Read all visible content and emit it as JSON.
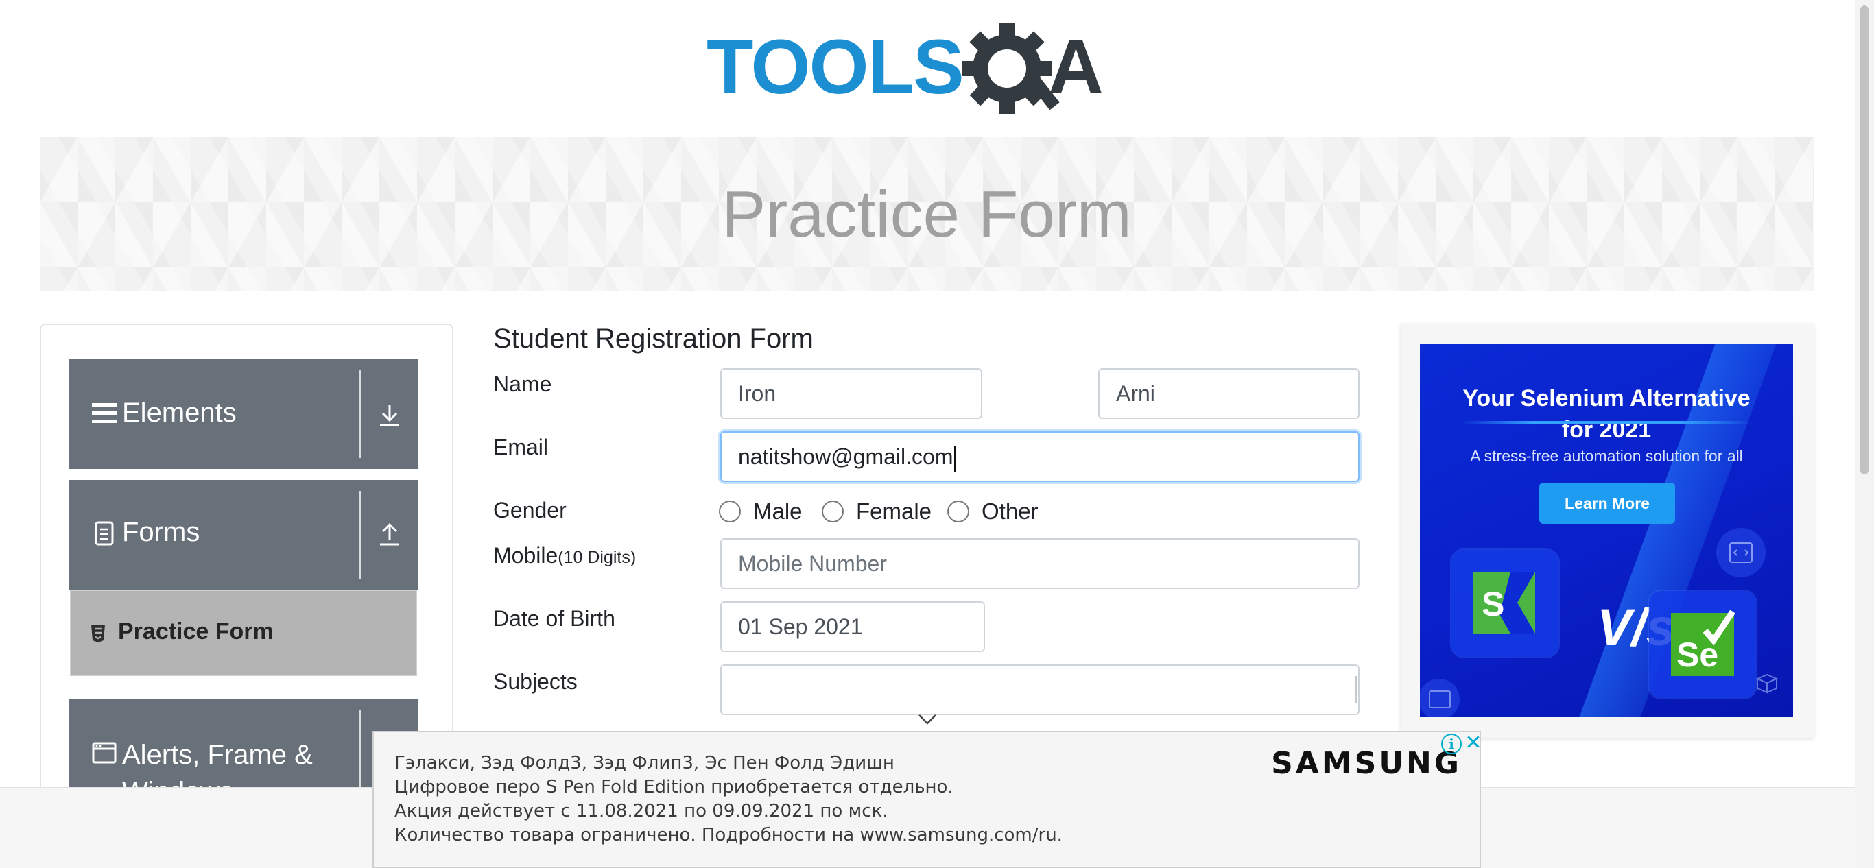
{
  "logo": {
    "text_part": "TOOLS",
    "qa_part": "QA",
    "colors": {
      "tools": "#1b8fd2",
      "qa": "#333a40"
    }
  },
  "banner": {
    "title": "Practice Form"
  },
  "sidebar": {
    "groups": [
      {
        "label": "Elements",
        "icon": "hamburger-icon",
        "toggle_icon": "download-arrow-icon",
        "expanded": false
      },
      {
        "label": "Forms",
        "icon": "document-icon",
        "toggle_icon": "upload-arrow-icon",
        "expanded": true,
        "items": [
          {
            "label": "Practice Form",
            "icon": "html5-icon",
            "active": true
          }
        ]
      },
      {
        "label": "Alerts, Frame &",
        "label_line2": "Windows",
        "icon": "window-icon"
      }
    ]
  },
  "form": {
    "title": "Student Registration Form",
    "labels": {
      "name": "Name",
      "email": "Email",
      "gender": "Gender",
      "mobile": "Mobile",
      "mobile_hint": "(10 Digits)",
      "dob": "Date of Birth",
      "subjects": "Subjects"
    },
    "first_name": {
      "value": "Iron"
    },
    "last_name": {
      "value": "Arni"
    },
    "email": {
      "value": "natitshow@gmail.com",
      "focused": true
    },
    "gender_options": [
      "Male",
      "Female",
      "Other"
    ],
    "mobile": {
      "placeholder": "Mobile Number",
      "value": ""
    },
    "dob": {
      "value": "01 Sep 2021"
    },
    "subjects": {
      "value": ""
    }
  },
  "ad_right": {
    "headline_line1": "Your Selenium Alternative",
    "headline_line2": "for 2021",
    "subtitle": "A stress-free automation solution for all",
    "cta": "Learn More",
    "vs": "V/s",
    "se_label": "Se",
    "colors": {
      "bg": "#0a23cf",
      "cta": "#1e9cf2",
      "katalon": "#4bb543",
      "selenium": "#43b02a"
    }
  },
  "ad_bottom": {
    "lines": [
      "Гэлакси, Зэд Фолд3, Зэд Флип3, Эс Пен Фолд Эдишн",
      "Цифровое перо S Pen Fold Edition приобретается отдельно.",
      "Акция действует с 11.08.2021 по 09.09.2021 по мск.",
      "Количество товара ограничено. Подробности на www.samsung.com/ru."
    ],
    "brand": "SAMSUNG",
    "info_icon": "i",
    "close_icon": "✕"
  }
}
